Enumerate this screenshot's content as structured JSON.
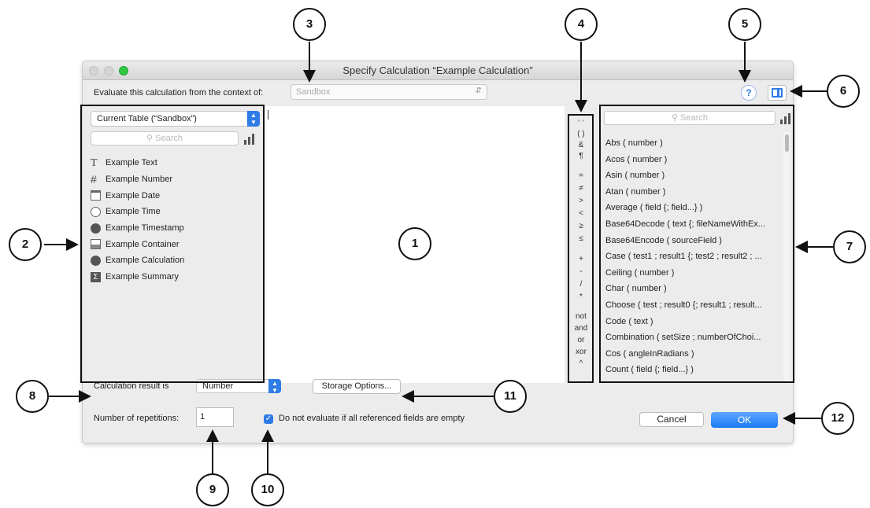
{
  "window": {
    "title": "Specify Calculation “Example Calculation”",
    "context_label": "Evaluate this calculation from the context of:",
    "context_value": "Sandbox",
    "help_label": "?"
  },
  "left_panel": {
    "table_select": "Current Table (“Sandbox”)",
    "search_placeholder": "Search",
    "fields": [
      {
        "label": "Example Text",
        "icon": "text-icon"
      },
      {
        "label": "Example Number",
        "icon": "number-icon"
      },
      {
        "label": "Example Date",
        "icon": "date-icon"
      },
      {
        "label": "Example Time",
        "icon": "time-icon"
      },
      {
        "label": "Example Timestamp",
        "icon": "timestamp-icon"
      },
      {
        "label": "Example Container",
        "icon": "container-icon"
      },
      {
        "label": "Example Calculation",
        "icon": "calculation-icon"
      },
      {
        "label": "Example Summary",
        "icon": "summary-icon"
      }
    ]
  },
  "operators": [
    "\" \"",
    "( )",
    "&",
    "¶",
    "=",
    "≠",
    ">",
    "<",
    "≥",
    "≤",
    "+",
    "-",
    "/",
    "*",
    "not",
    "and",
    "or",
    "xor",
    "^"
  ],
  "functions": {
    "search_placeholder": "Search",
    "items": [
      "Abs ( number )",
      "Acos ( number )",
      "Asin ( number )",
      "Atan ( number )",
      "Average ( field {; field...} )",
      "Base64Decode ( text {; fileNameWithEx...",
      "Base64Encode ( sourceField )",
      "Case ( test1 ; result1 {; test2 ; result2 ; ...",
      "Ceiling ( number )",
      "Char ( number )",
      "Choose ( test ; result0 {; result1 ; result...",
      "Code ( text )",
      "Combination ( setSize ; numberOfChoi...",
      "Cos ( angleInRadians )",
      "Count ( field {; field...} )"
    ]
  },
  "bottom": {
    "result_label": "Calculation result is",
    "result_value": "Number",
    "storage_button": "Storage Options...",
    "repetitions_label": "Number of repetitions:",
    "repetitions_value": "1",
    "checkbox_label": "Do not evaluate if all referenced fields are empty",
    "cancel_button": "Cancel",
    "ok_button": "OK"
  },
  "callouts": [
    "1",
    "2",
    "3",
    "4",
    "5",
    "6",
    "7",
    "8",
    "9",
    "10",
    "11",
    "12"
  ]
}
